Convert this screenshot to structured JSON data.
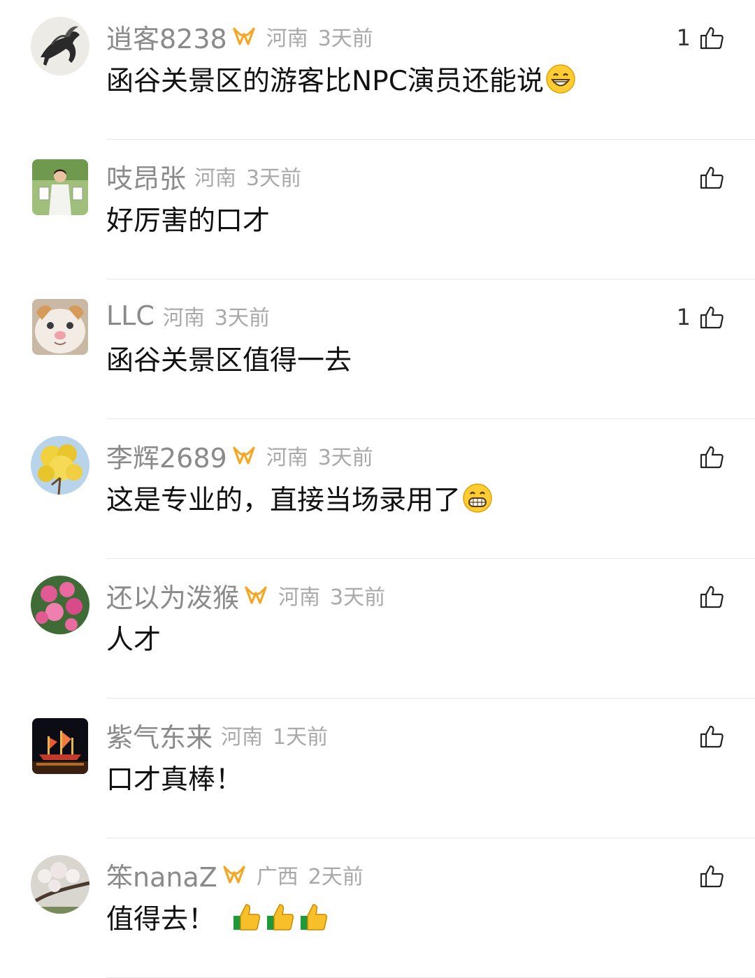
{
  "comments": [
    {
      "username": "逍客8238",
      "vip": true,
      "location": "河南",
      "time": "3天前",
      "text": "函谷关景区的游客比NPC演员还能说",
      "emoji": "grinning-face",
      "likes": "1"
    },
    {
      "username": "吱昂张",
      "vip": false,
      "location": "河南",
      "time": "3天前",
      "text": "好厉害的口才",
      "emoji": "",
      "likes": ""
    },
    {
      "username": "LLC",
      "vip": false,
      "location": "河南",
      "time": "3天前",
      "text": "函谷关景区值得一去",
      "emoji": "",
      "likes": "1"
    },
    {
      "username": "李辉2689",
      "vip": true,
      "location": "河南",
      "time": "3天前",
      "text": "这是专业的，直接当场录用了",
      "emoji": "grimacing-face",
      "likes": ""
    },
    {
      "username": "还以为泼猴",
      "vip": true,
      "location": "河南",
      "time": "3天前",
      "text": "人才",
      "emoji": "",
      "likes": ""
    },
    {
      "username": "紫气东来",
      "vip": false,
      "location": "河南",
      "time": "1天前",
      "text": "口才真棒！",
      "emoji": "",
      "likes": ""
    },
    {
      "username": "笨nanaZ",
      "vip": true,
      "location": "广西",
      "time": "2天前",
      "text": "值得去！",
      "emoji": "thumbs-up x3",
      "likes": ""
    }
  ],
  "colors": {
    "username": "#8a8a8a",
    "meta": "#a9a9a9",
    "vip": "#f5a623",
    "divider": "#e6e6e6"
  }
}
